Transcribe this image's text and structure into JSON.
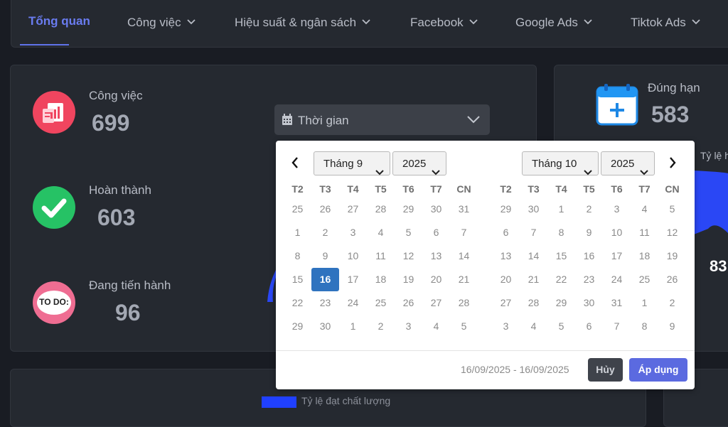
{
  "nav": {
    "items": [
      {
        "label": "Tổng quan",
        "active": true,
        "dropdown": false
      },
      {
        "label": "Công việc",
        "dropdown": true
      },
      {
        "label": "Hiệu suất & ngân sách",
        "dropdown": true
      },
      {
        "label": "Facebook",
        "dropdown": true
      },
      {
        "label": "Google Ads",
        "dropdown": true
      },
      {
        "label": "Tiktok Ads",
        "dropdown": true
      }
    ]
  },
  "stats": [
    {
      "label": "Công việc",
      "value": "699",
      "icon": "report-chart-icon"
    },
    {
      "label": "Hoàn thành",
      "value": "603",
      "icon": "check-circle-icon"
    },
    {
      "label": "Đang tiến hành",
      "value": "96",
      "icon": "todo-icon",
      "icon_text": "TO DO:"
    }
  ],
  "time_filter": {
    "label": "Thời gian",
    "icon": "calendar-icon"
  },
  "right_card": {
    "label": "Đúng hạn",
    "value": "583",
    "icon": "calendar-plus-icon",
    "partial_label": "Tỷ lệ h",
    "partial_value": "83"
  },
  "datepicker": {
    "left": {
      "month": "Tháng 9",
      "year": "2025",
      "weekdays": [
        "T2",
        "T3",
        "T4",
        "T5",
        "T6",
        "T7",
        "CN"
      ],
      "weeks": [
        [
          "25",
          "26",
          "27",
          "28",
          "29",
          "30",
          "31"
        ],
        [
          "1",
          "2",
          "3",
          "4",
          "5",
          "6",
          "7"
        ],
        [
          "8",
          "9",
          "10",
          "11",
          "12",
          "13",
          "14"
        ],
        [
          "15",
          "16",
          "17",
          "18",
          "19",
          "20",
          "21"
        ],
        [
          "22",
          "23",
          "24",
          "25",
          "26",
          "27",
          "28"
        ],
        [
          "29",
          "30",
          "1",
          "2",
          "3",
          "4",
          "5"
        ]
      ],
      "selected_day": "16"
    },
    "right": {
      "month": "Tháng 10",
      "year": "2025",
      "weekdays": [
        "T2",
        "T3",
        "T4",
        "T5",
        "T6",
        "T7",
        "CN"
      ],
      "weeks": [
        [
          "29",
          "30",
          "1",
          "2",
          "3",
          "4",
          "5"
        ],
        [
          "6",
          "7",
          "8",
          "9",
          "10",
          "11",
          "12"
        ],
        [
          "13",
          "14",
          "15",
          "16",
          "17",
          "18",
          "19"
        ],
        [
          "20",
          "21",
          "22",
          "23",
          "24",
          "25",
          "26"
        ],
        [
          "27",
          "28",
          "29",
          "30",
          "31",
          "1",
          "2"
        ],
        [
          "3",
          "4",
          "5",
          "6",
          "7",
          "8",
          "9"
        ]
      ]
    },
    "range_text": "16/09/2025 - 16/09/2025",
    "cancel_label": "Hủy",
    "apply_label": "Áp dụng"
  },
  "legend": {
    "label": "Tỷ lệ đạt chất lượng",
    "color": "#2040ff"
  },
  "colors": {
    "accent": "#5b6ae0",
    "selected_day": "#2f73bf",
    "chart_blue": "#2a47f5"
  }
}
